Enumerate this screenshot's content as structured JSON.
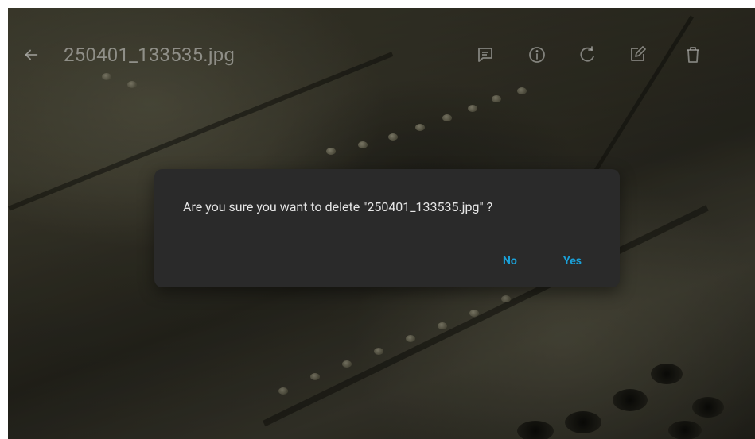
{
  "appbar": {
    "title": "250401_133535.jpg",
    "icon_color": "#c8c8c3"
  },
  "actions": [
    {
      "name": "comment-icon"
    },
    {
      "name": "info-icon"
    },
    {
      "name": "rotate-icon"
    },
    {
      "name": "edit-icon"
    },
    {
      "name": "delete-icon"
    }
  ],
  "dialog": {
    "message": "Are you sure you want to delete \"250401_133535.jpg\" ?",
    "no_label": "No",
    "yes_label": "Yes",
    "accent_color": "#1aa0d8",
    "background_color": "#2a2a2a"
  }
}
